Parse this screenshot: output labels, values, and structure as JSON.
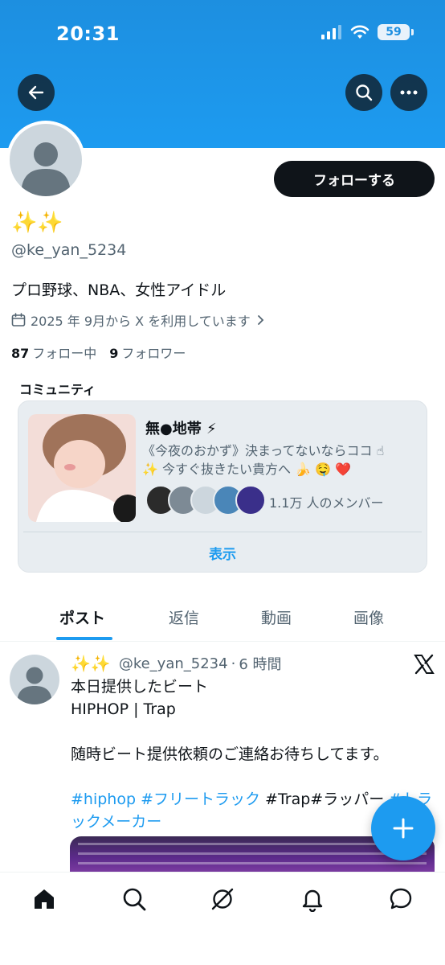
{
  "status_bar": {
    "time": "20:31",
    "battery": "59",
    "icons": [
      "signal-icon",
      "wifi-icon",
      "battery-icon"
    ]
  },
  "header": {
    "back_icon": "arrow-left-icon",
    "search_icon": "search-icon",
    "more_icon": "more-horizontal-icon",
    "banner_color": "#1d9bf0"
  },
  "profile": {
    "display_name": "✨✨",
    "handle": "@ke_yan_5234",
    "follow_button": "フォローする",
    "bio": "プロ野球、NBA、女性アイドル",
    "joined": "2025 年 9月から X を利用しています",
    "following_count": "87",
    "following_label": "フォロー中",
    "followers_count": "9",
    "followers_label": "フォロワー"
  },
  "community": {
    "section_label": "コミュニティ",
    "name": "無●地帯 ⚡",
    "description_line1": "《今夜のおかず》決まってないならココ ☝",
    "description_line2": "✨ 今すぐ抜きたい貴方へ 🍌 🤤 ❤️",
    "member_count": "1.1万 人のメンバー",
    "view_button": "表示"
  },
  "tabs": [
    {
      "label": "ポスト",
      "active": true
    },
    {
      "label": "返信",
      "active": false
    },
    {
      "label": "動画",
      "active": false
    },
    {
      "label": "画像",
      "active": false
    }
  ],
  "post": {
    "author_name": "✨✨",
    "author_handle": "@ke_yan_5234",
    "separator": "·",
    "time": "6 時間",
    "line1": "本日提供したビート",
    "line2": "HIPHOP | Trap",
    "line3": "随時ビート提供依頼のご連絡お待ちしてます。",
    "tag1": "#hiphop",
    "tag2": "#フリートラック",
    "plain_tags": "#Trap#ラッパー",
    "tag3": "#トラックメーカー"
  },
  "fab": {
    "icon": "plus-icon"
  },
  "bottom_nav": [
    "home-icon",
    "search-icon",
    "grok-icon",
    "notifications-icon",
    "messages-icon"
  ],
  "colors": {
    "accent": "#1d9bf0",
    "text": "#0f1419",
    "muted": "#536471"
  }
}
